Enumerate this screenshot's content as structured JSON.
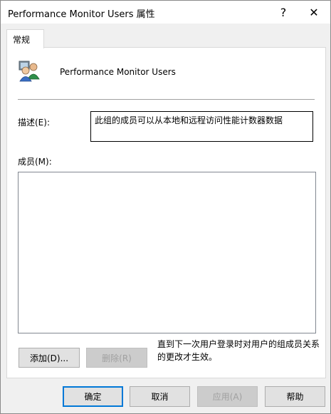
{
  "window": {
    "title": "Performance Monitor Users 属性",
    "help_glyph": "?",
    "close_glyph": "✕"
  },
  "tabs": [
    {
      "label": "常规"
    }
  ],
  "general": {
    "group_icon": "group-users-icon",
    "group_name": "Performance Monitor Users",
    "description_label": "描述(E):",
    "description_value": "此组的成员可以从本地和远程访问性能计数器数据",
    "members_label": "成员(M):",
    "members": [],
    "add_button": "添加(D)...",
    "remove_button": "删除(R)",
    "note": "直到下一次用户登录时对用户的组成员关系的更改才生效。"
  },
  "footer": {
    "ok": "确定",
    "cancel": "取消",
    "apply": "应用(A)",
    "help": "帮助"
  }
}
